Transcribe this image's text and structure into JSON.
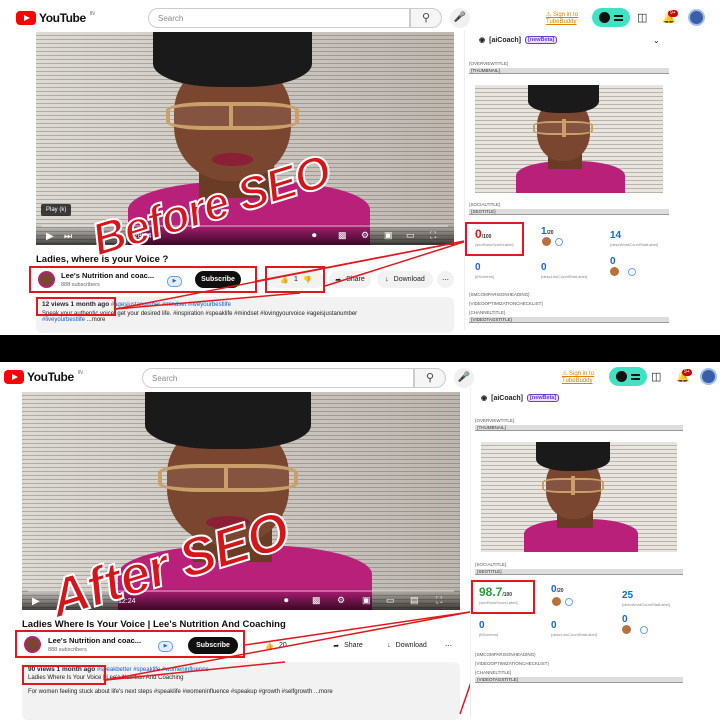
{
  "app": {
    "logo_text": "YouTube",
    "logo_sup": "IN"
  },
  "search": {
    "placeholder": "Search",
    "icon": "search-icon"
  },
  "header": {
    "sign_in_line1": "Sign in to",
    "sign_in_line2": "TubeBuddy",
    "notifications_badge": "9+"
  },
  "before": {
    "overlay_text": "Before SEO",
    "tooltip": "Play (k)",
    "time": "1:28:24",
    "title": "Ladies, where is your Voice ?",
    "channel_name": "Lee's Nutrition and coac...",
    "subscribers": "888 subscribers",
    "subscribe_label": "Subscribe",
    "likes": "1",
    "share_label": "Share",
    "download_label": "Download",
    "views_date": "12 views  1 month ago",
    "hashtags_line": "#agesjustanumber #mindset #liveyourbestlife",
    "desc_line": "Speak your authentic voice, get your desired life. #inspiration #speaklife #mindset #lovingyourvoice #ageisjustanumber",
    "desc_line2": "#liveyourbestlife",
    "more": "...more",
    "score": "0",
    "score_max": "/100",
    "score_label": "{seoRankScoreLabel}",
    "pos": "1",
    "pos_max": "/20",
    "count": "14",
    "count_label": "{descWordCountStatLabel}",
    "tl_count": "0",
    "tl_label": "{tlScreens}",
    "link_count": "0",
    "link_label": "{descLinkCountStatLabel}",
    "side_count": "0"
  },
  "after": {
    "overlay_text": "After SEO",
    "time": "12:24",
    "title": "Ladies Where Is Your Voice | Lee's Nutrition And Coaching",
    "channel_name": "Lee's Nutrition and coac...",
    "subscribers": "888 subscribers",
    "subscribe_label": "Subscribe",
    "likes": "20",
    "share_label": "Share",
    "download_label": "Download",
    "views_date": "90 views  1 month ago",
    "hashtags_line": "#speakbetter #speaklife #womeninfluence",
    "desc_line": "Ladies Where Is Your Voice | Lee's Nutrition And Coaching",
    "desc_line2": "For women feeling stuck about life's next steps #speaklife #womeninfluence #speakup #growth #selfgrowth",
    "more": "...more",
    "score": "98.7",
    "score_max": "/100",
    "score_label": "{seoRankScoreLabel}",
    "pos": "0",
    "pos_max": "/20",
    "count": "25",
    "count_label": "{descWordCountStatLabel}",
    "tl_count": "0",
    "tl_label": "{tlScreens}",
    "link_count": "0",
    "link_label": "{descLinkCountStatLabel}",
    "side_count": "0"
  },
  "sidebar": {
    "head_label": "[aiCoach]",
    "beta_label": "[newBeta]",
    "overview_title": "{OVERVIEWTITLE}",
    "thumbnail": "{THUMBNAIL}",
    "social_title": "{SOCIALTITLE}",
    "seo_title": "{SEOTITLE}",
    "comparison_heading": "{SMCOMPARISONHEADING}",
    "optimization_checklist": "{VIDEOOPTIMIZATIONCHECKLIST}",
    "channel_title": "{CHANNELTITLE}",
    "video_tags_title": "{VIDEOTAGSTITLE}"
  },
  "colors": {
    "accent": "#3fe3c4",
    "highlight": "#e0191f",
    "score_bad": "#d11a1a",
    "score_good": "#2a9d3a",
    "link": "#065fd4"
  }
}
